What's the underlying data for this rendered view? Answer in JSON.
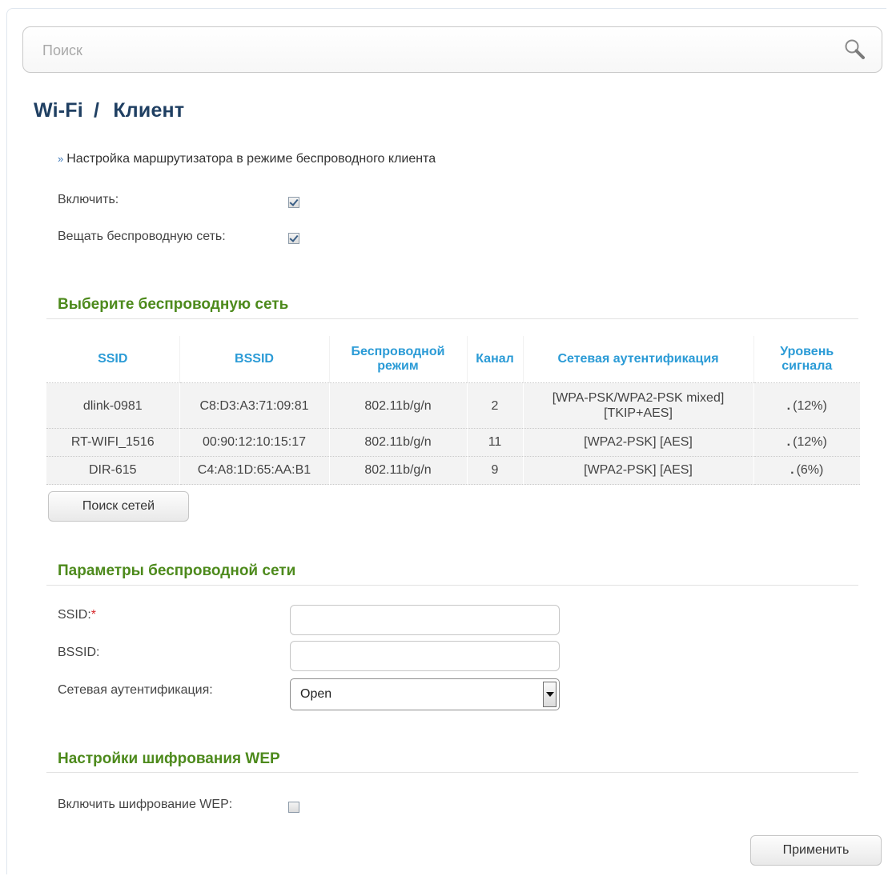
{
  "search": {
    "placeholder": "Поиск"
  },
  "breadcrumb": {
    "section": "Wi-Fi",
    "separator": "/",
    "page": "Клиент"
  },
  "description": "Настройка маршрутизатора в режиме беспроводного клиента",
  "general": {
    "enable_label": "Включить:",
    "enable_checked": true,
    "broadcast_label": "Вещать беспроводную сеть:",
    "broadcast_checked": true
  },
  "networks": {
    "heading": "Выберите беспроводную сеть",
    "columns": {
      "ssid": "SSID",
      "bssid": "BSSID",
      "mode": "Беспроводной режим",
      "channel": "Канал",
      "auth": "Сетевая аутентификация",
      "signal": "Уровень сигнала"
    },
    "rows": [
      {
        "ssid": "dlink-0981",
        "bssid": "C8:D3:A3:71:09:81",
        "mode": "802.11b/g/n",
        "channel": "2",
        "auth": "[WPA-PSK/WPA2-PSK mixed] [TKIP+AES]",
        "signal_dot": ".",
        "signal": "(12%)"
      },
      {
        "ssid": "RT-WIFI_1516",
        "bssid": "00:90:12:10:15:17",
        "mode": "802.11b/g/n",
        "channel": "11",
        "auth": "[WPA2-PSK] [AES]",
        "signal_dot": ".",
        "signal": "(12%)"
      },
      {
        "ssid": "DIR-615",
        "bssid": "C4:A8:1D:65:AA:B1",
        "mode": "802.11b/g/n",
        "channel": "9",
        "auth": "[WPA2-PSK] [AES]",
        "signal_dot": ".",
        "signal": "(6%)"
      }
    ],
    "scan_button": "Поиск сетей"
  },
  "params": {
    "heading": "Параметры беспроводной сети",
    "ssid_label": "SSID:",
    "required_mark": "*",
    "ssid_value": "",
    "bssid_label": "BSSID:",
    "bssid_value": "",
    "auth_label": "Сетевая аутентификация:",
    "auth_value": "Open"
  },
  "wep": {
    "heading": "Настройки шифрования WEP",
    "enable_label": "Включить шифрование WEP:",
    "enable_checked": false
  },
  "apply_button": "Применить"
}
